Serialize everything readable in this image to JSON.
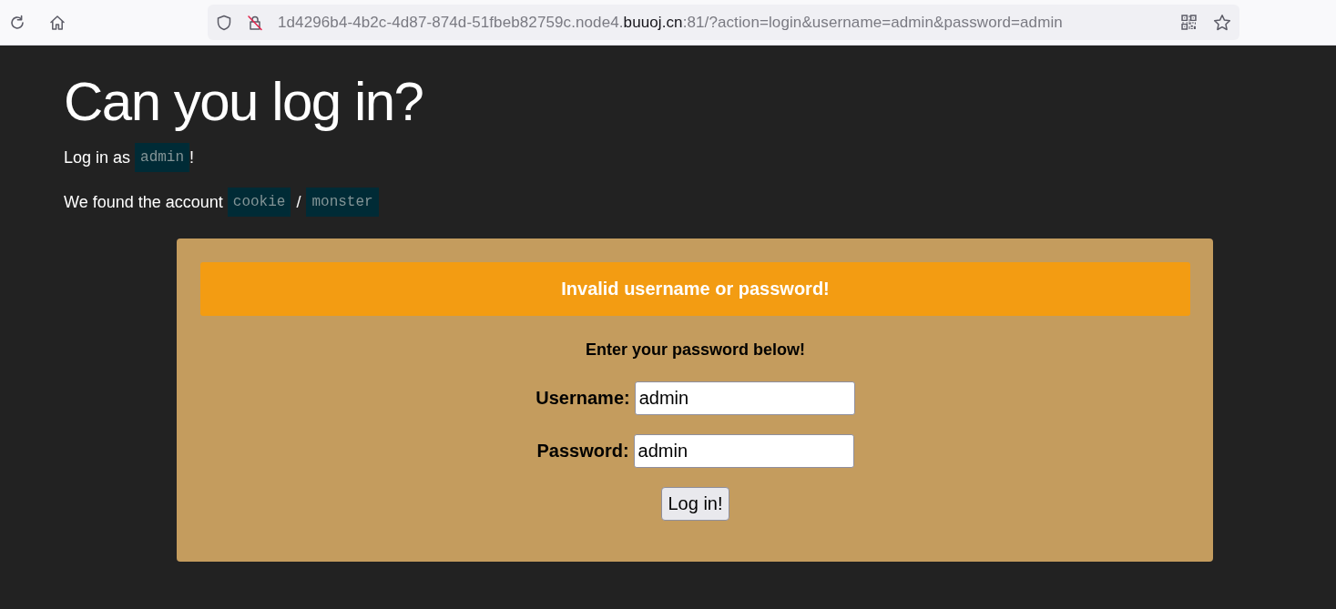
{
  "browser": {
    "url": {
      "prefix": "1d4296b4-4b2c-4d87-874d-51fbeb82759c.node4.",
      "domain": "buuoj.cn",
      "suffix": ":81/?action=login&username=admin&password=admin"
    }
  },
  "page": {
    "title": "Can you log in?",
    "login_hint": {
      "text": "Log in as",
      "code": "admin",
      "end": "!"
    },
    "account_hint": {
      "text": "We found the account",
      "username": "cookie",
      "separator": "/",
      "password": "monster"
    }
  },
  "panel": {
    "alert": "Invalid username or password!",
    "heading": "Enter your password below!",
    "fields": [
      {
        "label": "Username:",
        "value": "admin"
      },
      {
        "label": "Password:",
        "value": "admin"
      }
    ],
    "submit": "Log in!"
  }
}
